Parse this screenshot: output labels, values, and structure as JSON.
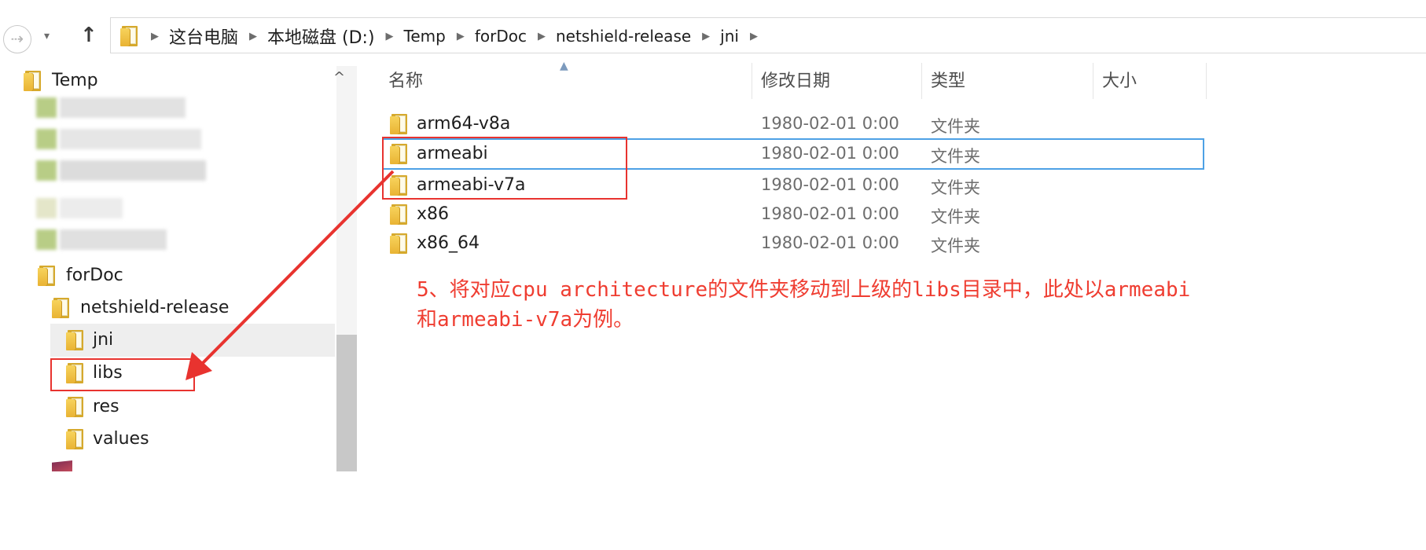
{
  "nav": {
    "back_glyph": "⇢",
    "dropdown_glyph": "▾",
    "up_glyph": "↑",
    "breadcrumbs": [
      "这台电脑",
      "本地磁盘 (D:)",
      "Temp",
      "forDoc",
      "netshield-release",
      "jni"
    ]
  },
  "tree": {
    "items": [
      {
        "label": "Temp",
        "icon": "folder-icon"
      },
      {
        "label": "forDoc",
        "icon": "folder-icon"
      },
      {
        "label": "netshield-release",
        "icon": "folder-icon"
      },
      {
        "label": "jni",
        "icon": "folder-icon"
      },
      {
        "label": "libs",
        "icon": "folder-icon"
      },
      {
        "label": "res",
        "icon": "folder-icon"
      },
      {
        "label": "values",
        "icon": "folder-icon"
      }
    ],
    "scroll_up_glyph": "^"
  },
  "list": {
    "columns": {
      "name": "名称",
      "date": "修改日期",
      "type": "类型",
      "size": "大小"
    },
    "sort_glyph": "▲",
    "rows": [
      {
        "name": "arm64-v8a",
        "date": "1980-02-01 0:00",
        "type": "文件夹",
        "selected": false
      },
      {
        "name": "armeabi",
        "date": "1980-02-01 0:00",
        "type": "文件夹",
        "selected": true
      },
      {
        "name": "armeabi-v7a",
        "date": "1980-02-01 0:00",
        "type": "文件夹",
        "selected": false
      },
      {
        "name": "x86",
        "date": "1980-02-01 0:00",
        "type": "文件夹",
        "selected": false
      },
      {
        "name": "x86_64",
        "date": "1980-02-01 0:00",
        "type": "文件夹",
        "selected": false
      }
    ]
  },
  "annotation": {
    "line1": "5、将对应cpu architecture的文件夹移动到上级的libs目录中，此处以armeabi",
    "line2": "和armeabi-v7a为例。",
    "color": "#e8332f"
  },
  "colors": {
    "selection_border": "#4ea1e5",
    "folder_yellow": "#f2c94c",
    "hover_gray": "#eeeeee"
  }
}
